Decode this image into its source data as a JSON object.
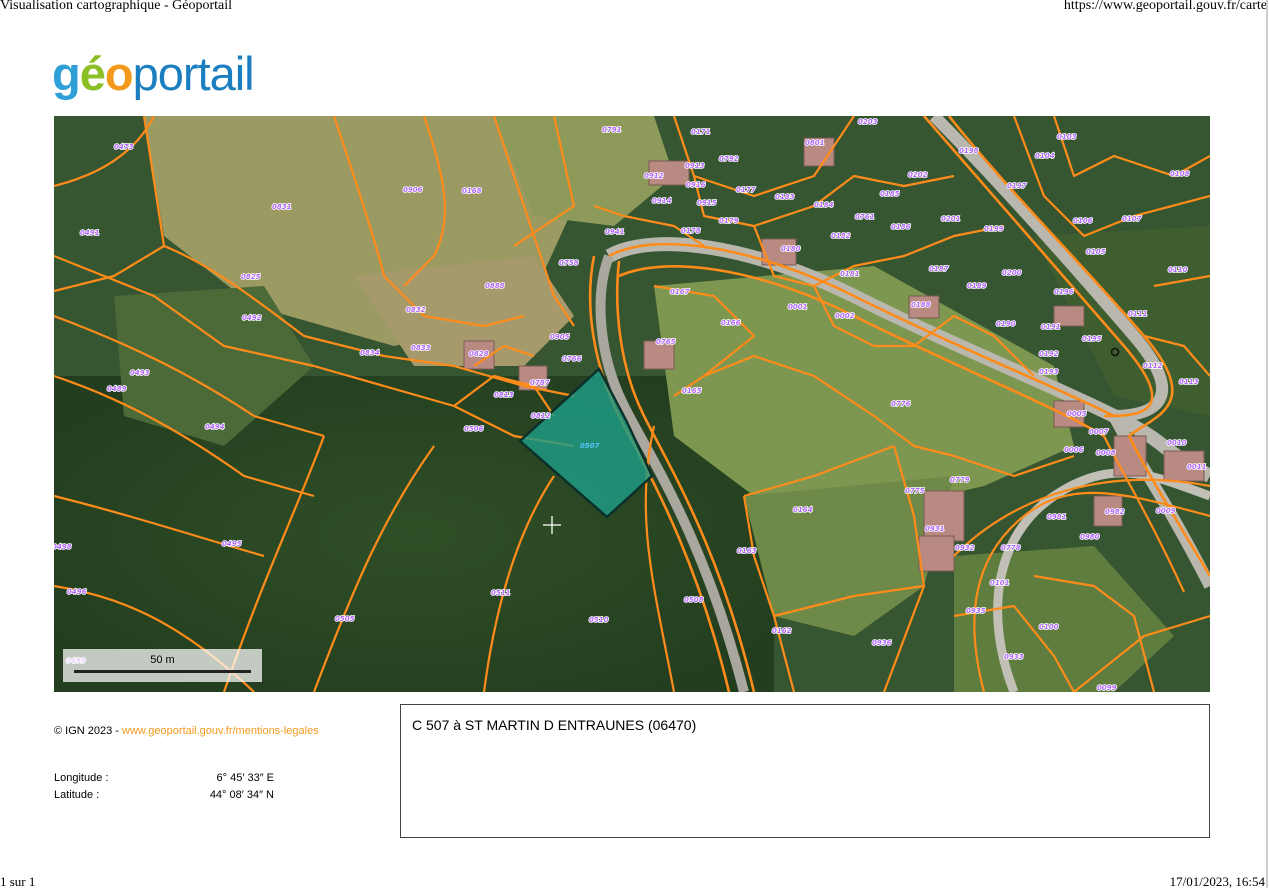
{
  "browser": {
    "page_title": "Visualisation cartographique - Géoportail",
    "url": "https://www.geoportail.gouv.fr/carte",
    "page_count": "1 sur 1",
    "print_datetime": "17/01/2023, 16:54"
  },
  "logo": {
    "part1": "g",
    "part2": "é",
    "part3": "o",
    "part4": "portail"
  },
  "map": {
    "scale_label": "50 m",
    "highlighted_parcel": "0507",
    "parcel_labels": [
      "0473",
      "0491",
      "0831",
      "0825",
      "0906",
      "0168",
      "0492",
      "0489",
      "0493",
      "0494",
      "0498",
      "0495",
      "0496",
      "0832",
      "0834",
      "0833",
      "0888",
      "0758",
      "0941",
      "0791",
      "0171",
      "0792",
      "0913",
      "0912",
      "0916",
      "0914",
      "0915",
      "0177",
      "0179",
      "0178",
      "0801",
      "0183",
      "0184",
      "0203",
      "0198",
      "0202",
      "0185",
      "0761",
      "0182",
      "0186",
      "0201",
      "0199",
      "0180",
      "0181",
      "0167",
      "0166",
      "0001",
      "0002",
      "0165",
      "0765",
      "0766",
      "0787",
      "0813",
      "0812",
      "0905",
      "0828",
      "0506",
      "0776",
      "0005",
      "0007",
      "0006",
      "0008",
      "0103",
      "0104",
      "0197",
      "0108",
      "0106",
      "0107",
      "0105",
      "0110",
      "0111",
      "0112",
      "0113",
      "0010",
      "0011",
      "0009",
      "0982",
      "0980",
      "0981",
      "0778",
      "0101",
      "0100",
      "0935",
      "0933",
      "0099",
      "0779",
      "0775",
      "0931",
      "0932",
      "0164",
      "0163",
      "0162",
      "0508",
      "0511",
      "0510",
      "0505",
      "0936",
      "0187",
      "0188",
      "0189",
      "0200",
      "0196",
      "0190",
      "0191",
      "0192",
      "0193",
      "0195",
      "0499"
    ],
    "colors": {
      "parcel_line": "#ff8c1a",
      "parcel_fill": "#1f9c86",
      "parcel_outline": "#0b2f2a",
      "label": "#b066ff"
    }
  },
  "credit": {
    "prefix": "© IGN 2023 - ",
    "link": "www.geoportail.gouv.fr/mentions-legales"
  },
  "coords": {
    "longitude_label": "Longitude :",
    "longitude_value": "6° 45′ 33″ E",
    "latitude_label": "Latitude :",
    "latitude_value": "44° 08′ 34″ N"
  },
  "info_box": {
    "text": "C 507 à ST MARTIN D ENTRAUNES (06470)"
  }
}
